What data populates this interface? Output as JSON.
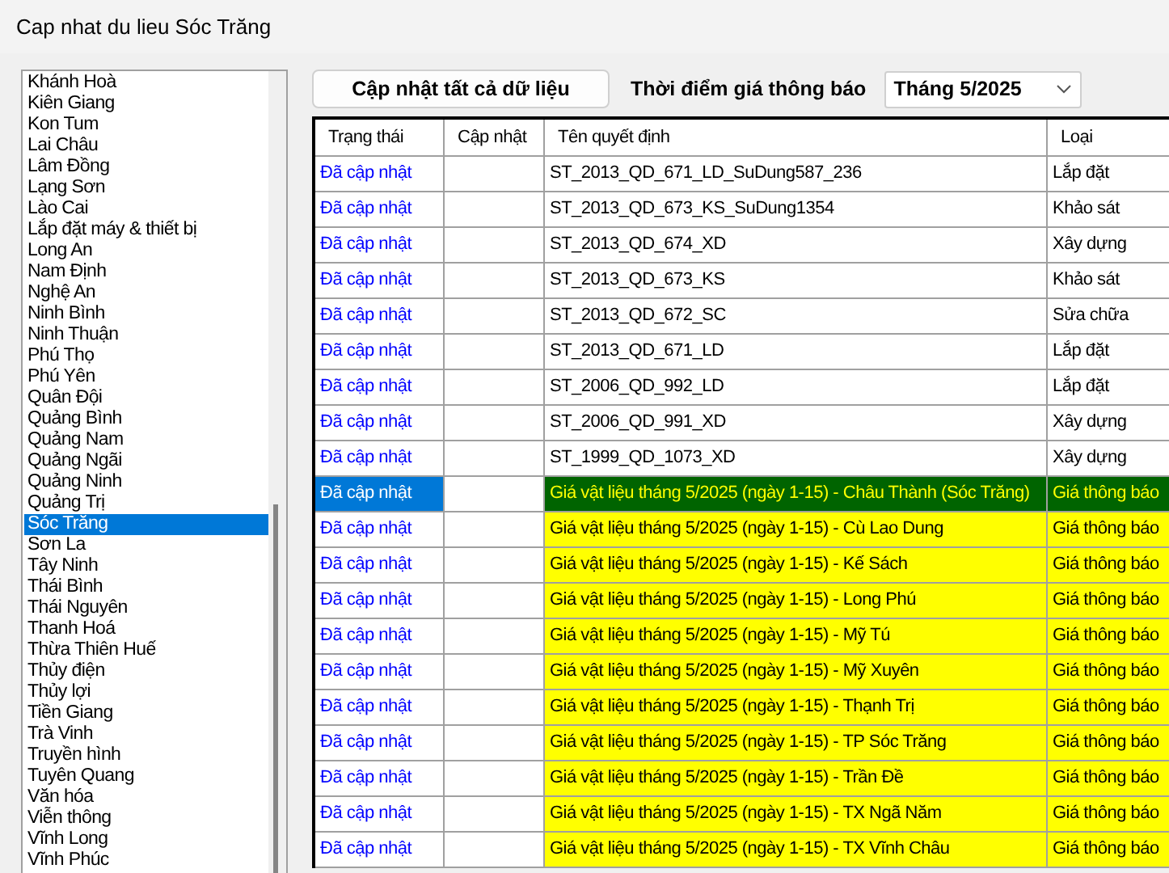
{
  "window": {
    "title": "Cap nhat du lieu Sóc Trăng"
  },
  "province_list": {
    "items": [
      {
        "label": "Khánh Hoà",
        "selected": false
      },
      {
        "label": "Kiên Giang",
        "selected": false
      },
      {
        "label": "Kon Tum",
        "selected": false
      },
      {
        "label": "Lai Châu",
        "selected": false
      },
      {
        "label": "Lâm Đồng",
        "selected": false
      },
      {
        "label": "Lạng Sơn",
        "selected": false
      },
      {
        "label": "Lào Cai",
        "selected": false
      },
      {
        "label": "Lắp đặt máy & thiết bị",
        "selected": false
      },
      {
        "label": "Long An",
        "selected": false
      },
      {
        "label": "Nam Định",
        "selected": false
      },
      {
        "label": "Nghệ An",
        "selected": false
      },
      {
        "label": "Ninh Bình",
        "selected": false
      },
      {
        "label": "Ninh Thuận",
        "selected": false
      },
      {
        "label": "Phú Thọ",
        "selected": false
      },
      {
        "label": "Phú Yên",
        "selected": false
      },
      {
        "label": "Quân Đội",
        "selected": false
      },
      {
        "label": "Quảng Bình",
        "selected": false
      },
      {
        "label": "Quảng Nam",
        "selected": false
      },
      {
        "label": "Quảng Ngãi",
        "selected": false
      },
      {
        "label": "Quảng Ninh",
        "selected": false
      },
      {
        "label": "Quảng Trị",
        "selected": false
      },
      {
        "label": "Sóc Trăng",
        "selected": true
      },
      {
        "label": "Sơn La",
        "selected": false
      },
      {
        "label": "Tây Ninh",
        "selected": false
      },
      {
        "label": "Thái Bình",
        "selected": false
      },
      {
        "label": "Thái Nguyên",
        "selected": false
      },
      {
        "label": "Thanh Hoá",
        "selected": false
      },
      {
        "label": "Thừa Thiên Huế",
        "selected": false
      },
      {
        "label": "Thủy điện",
        "selected": false
      },
      {
        "label": "Thủy lợi",
        "selected": false
      },
      {
        "label": "Tiền Giang",
        "selected": false
      },
      {
        "label": "Trà Vinh",
        "selected": false
      },
      {
        "label": "Truyền hình",
        "selected": false
      },
      {
        "label": "Tuyên Quang",
        "selected": false
      },
      {
        "label": "Văn hóa",
        "selected": false
      },
      {
        "label": "Viễn thông",
        "selected": false
      },
      {
        "label": "Vĩnh Long",
        "selected": false
      },
      {
        "label": "Vĩnh Phúc",
        "selected": false
      }
    ]
  },
  "toolbar": {
    "update_all_button": "Cập nhật tất cả dữ liệu",
    "period_label": "Thời điểm giá thông báo",
    "period_select": "Tháng 5/2025"
  },
  "table": {
    "columns": [
      "Trạng thái",
      "Cập nhật",
      "Tên quyết định",
      "Loại"
    ],
    "rows": [
      {
        "kind": "decision",
        "selected": false,
        "status": "Đã cập nhật",
        "name": "ST_2013_QD_671_LD_SuDung587_236",
        "type": "Lắp đặt"
      },
      {
        "kind": "decision",
        "selected": false,
        "status": "Đã cập nhật",
        "name": "ST_2013_QD_673_KS_SuDung1354",
        "type": "Khảo sát"
      },
      {
        "kind": "decision",
        "selected": false,
        "status": "Đã cập nhật",
        "name": "ST_2013_QD_674_XD",
        "type": "Xây dựng"
      },
      {
        "kind": "decision",
        "selected": false,
        "status": "Đã cập nhật",
        "name": "ST_2013_QD_673_KS",
        "type": "Khảo sát"
      },
      {
        "kind": "decision",
        "selected": false,
        "status": "Đã cập nhật",
        "name": "ST_2013_QD_672_SC",
        "type": "Sửa chữa"
      },
      {
        "kind": "decision",
        "selected": false,
        "status": "Đã cập nhật",
        "name": "ST_2013_QD_671_LD",
        "type": "Lắp đặt"
      },
      {
        "kind": "decision",
        "selected": false,
        "status": "Đã cập nhật",
        "name": "ST_2006_QD_992_LD",
        "type": "Lắp đặt"
      },
      {
        "kind": "decision",
        "selected": false,
        "status": "Đã cập nhật",
        "name": "ST_2006_QD_991_XD",
        "type": "Xây dựng"
      },
      {
        "kind": "decision",
        "selected": false,
        "status": "Đã cập nhật",
        "name": "ST_1999_QD_1073_XD",
        "type": "Xây dựng"
      },
      {
        "kind": "price_notice",
        "selected": true,
        "status": "Đã cập nhật",
        "name": "Giá vật liệu tháng 5/2025 (ngày 1-15) - Châu Thành (Sóc Trăng)",
        "type": "Giá thông báo"
      },
      {
        "kind": "price_notice",
        "selected": false,
        "status": "Đã cập nhật",
        "name": "Giá vật liệu tháng 5/2025 (ngày 1-15) - Cù Lao Dung",
        "type": "Giá thông báo"
      },
      {
        "kind": "price_notice",
        "selected": false,
        "status": "Đã cập nhật",
        "name": "Giá vật liệu tháng 5/2025 (ngày 1-15) - Kế Sách",
        "type": "Giá thông báo"
      },
      {
        "kind": "price_notice",
        "selected": false,
        "status": "Đã cập nhật",
        "name": "Giá vật liệu tháng 5/2025 (ngày 1-15) - Long Phú",
        "type": "Giá thông báo"
      },
      {
        "kind": "price_notice",
        "selected": false,
        "status": "Đã cập nhật",
        "name": "Giá vật liệu tháng 5/2025 (ngày 1-15) - Mỹ Tú",
        "type": "Giá thông báo"
      },
      {
        "kind": "price_notice",
        "selected": false,
        "status": "Đã cập nhật",
        "name": "Giá vật liệu tháng 5/2025 (ngày 1-15) - Mỹ Xuyên",
        "type": "Giá thông báo"
      },
      {
        "kind": "price_notice",
        "selected": false,
        "status": "Đã cập nhật",
        "name": "Giá vật liệu tháng 5/2025 (ngày 1-15) - Thạnh Trị",
        "type": "Giá thông báo"
      },
      {
        "kind": "price_notice",
        "selected": false,
        "status": "Đã cập nhật",
        "name": "Giá vật liệu tháng 5/2025 (ngày 1-15) - TP Sóc Trăng",
        "type": "Giá thông báo"
      },
      {
        "kind": "price_notice",
        "selected": false,
        "status": "Đã cập nhật",
        "name": "Giá vật liệu tháng 5/2025 (ngày 1-15) - Trần Đề",
        "type": "Giá thông báo"
      },
      {
        "kind": "price_notice",
        "selected": false,
        "status": "Đã cập nhật",
        "name": "Giá vật liệu tháng 5/2025 (ngày 1-15) - TX Ngã Năm",
        "type": "Giá thông báo"
      },
      {
        "kind": "price_notice",
        "selected": false,
        "status": "Đã cập nhật",
        "name": "Giá vật liệu tháng 5/2025 (ngày 1-15) - TX Vĩnh Châu",
        "type": "Giá thông báo"
      }
    ]
  }
}
